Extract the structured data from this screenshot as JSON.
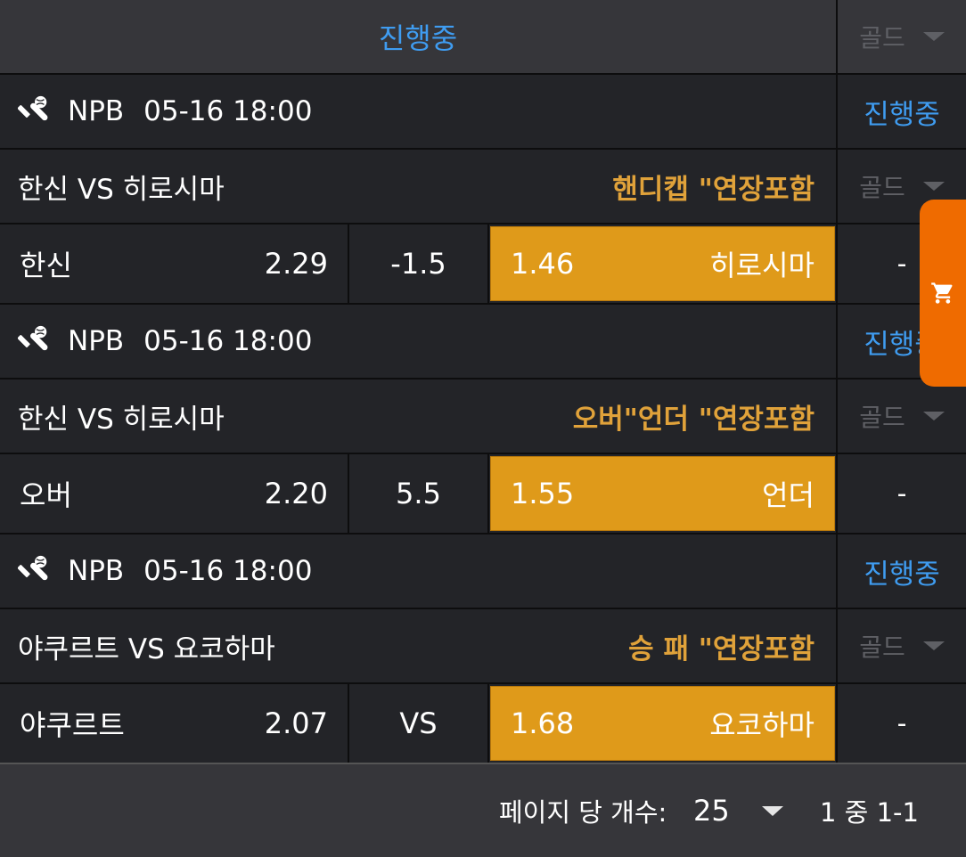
{
  "header": {
    "tab_label": "진행중",
    "gold_label": "골드"
  },
  "matches": [
    {
      "league": "NPB",
      "datetime": "05-16 18:00",
      "status": "진행중",
      "teams": "한신 VS 히로시마",
      "market": "핸디캡 \"연장포함",
      "gold_label": "골드",
      "home_name": "한신",
      "home_odds": "2.29",
      "line": "-1.5",
      "away_odds": "1.46",
      "away_name": "히로시마",
      "draw": "-"
    },
    {
      "league": "NPB",
      "datetime": "05-16 18:00",
      "status": "진행중",
      "teams": "한신 VS 히로시마",
      "market": "오버\"언더 \"연장포함",
      "gold_label": "골드",
      "home_name": "오버",
      "home_odds": "2.20",
      "line": "5.5",
      "away_odds": "1.55",
      "away_name": "언더",
      "draw": "-"
    },
    {
      "league": "NPB",
      "datetime": "05-16 18:00",
      "status": "진행중",
      "teams": "야쿠르트 VS 요코하마",
      "market": "승 패 \"연장포함",
      "gold_label": "골드",
      "home_name": "야쿠르트",
      "home_odds": "2.07",
      "line": "VS",
      "away_odds": "1.68",
      "away_name": "요코하마",
      "draw": "-"
    }
  ],
  "footer": {
    "per_page_label": "페이지 당 개수:",
    "per_page_value": "25",
    "range": "1 중 1-1"
  },
  "icons": {
    "sport": "baseball-icon",
    "cart": "cart-icon",
    "dropdown": "chevron-down-icon"
  },
  "colors": {
    "accent_blue": "#3f9cf0",
    "market_gold": "#e0a23a",
    "selected_bg": "#df9a1a",
    "cart_orange": "#ef6b00"
  }
}
